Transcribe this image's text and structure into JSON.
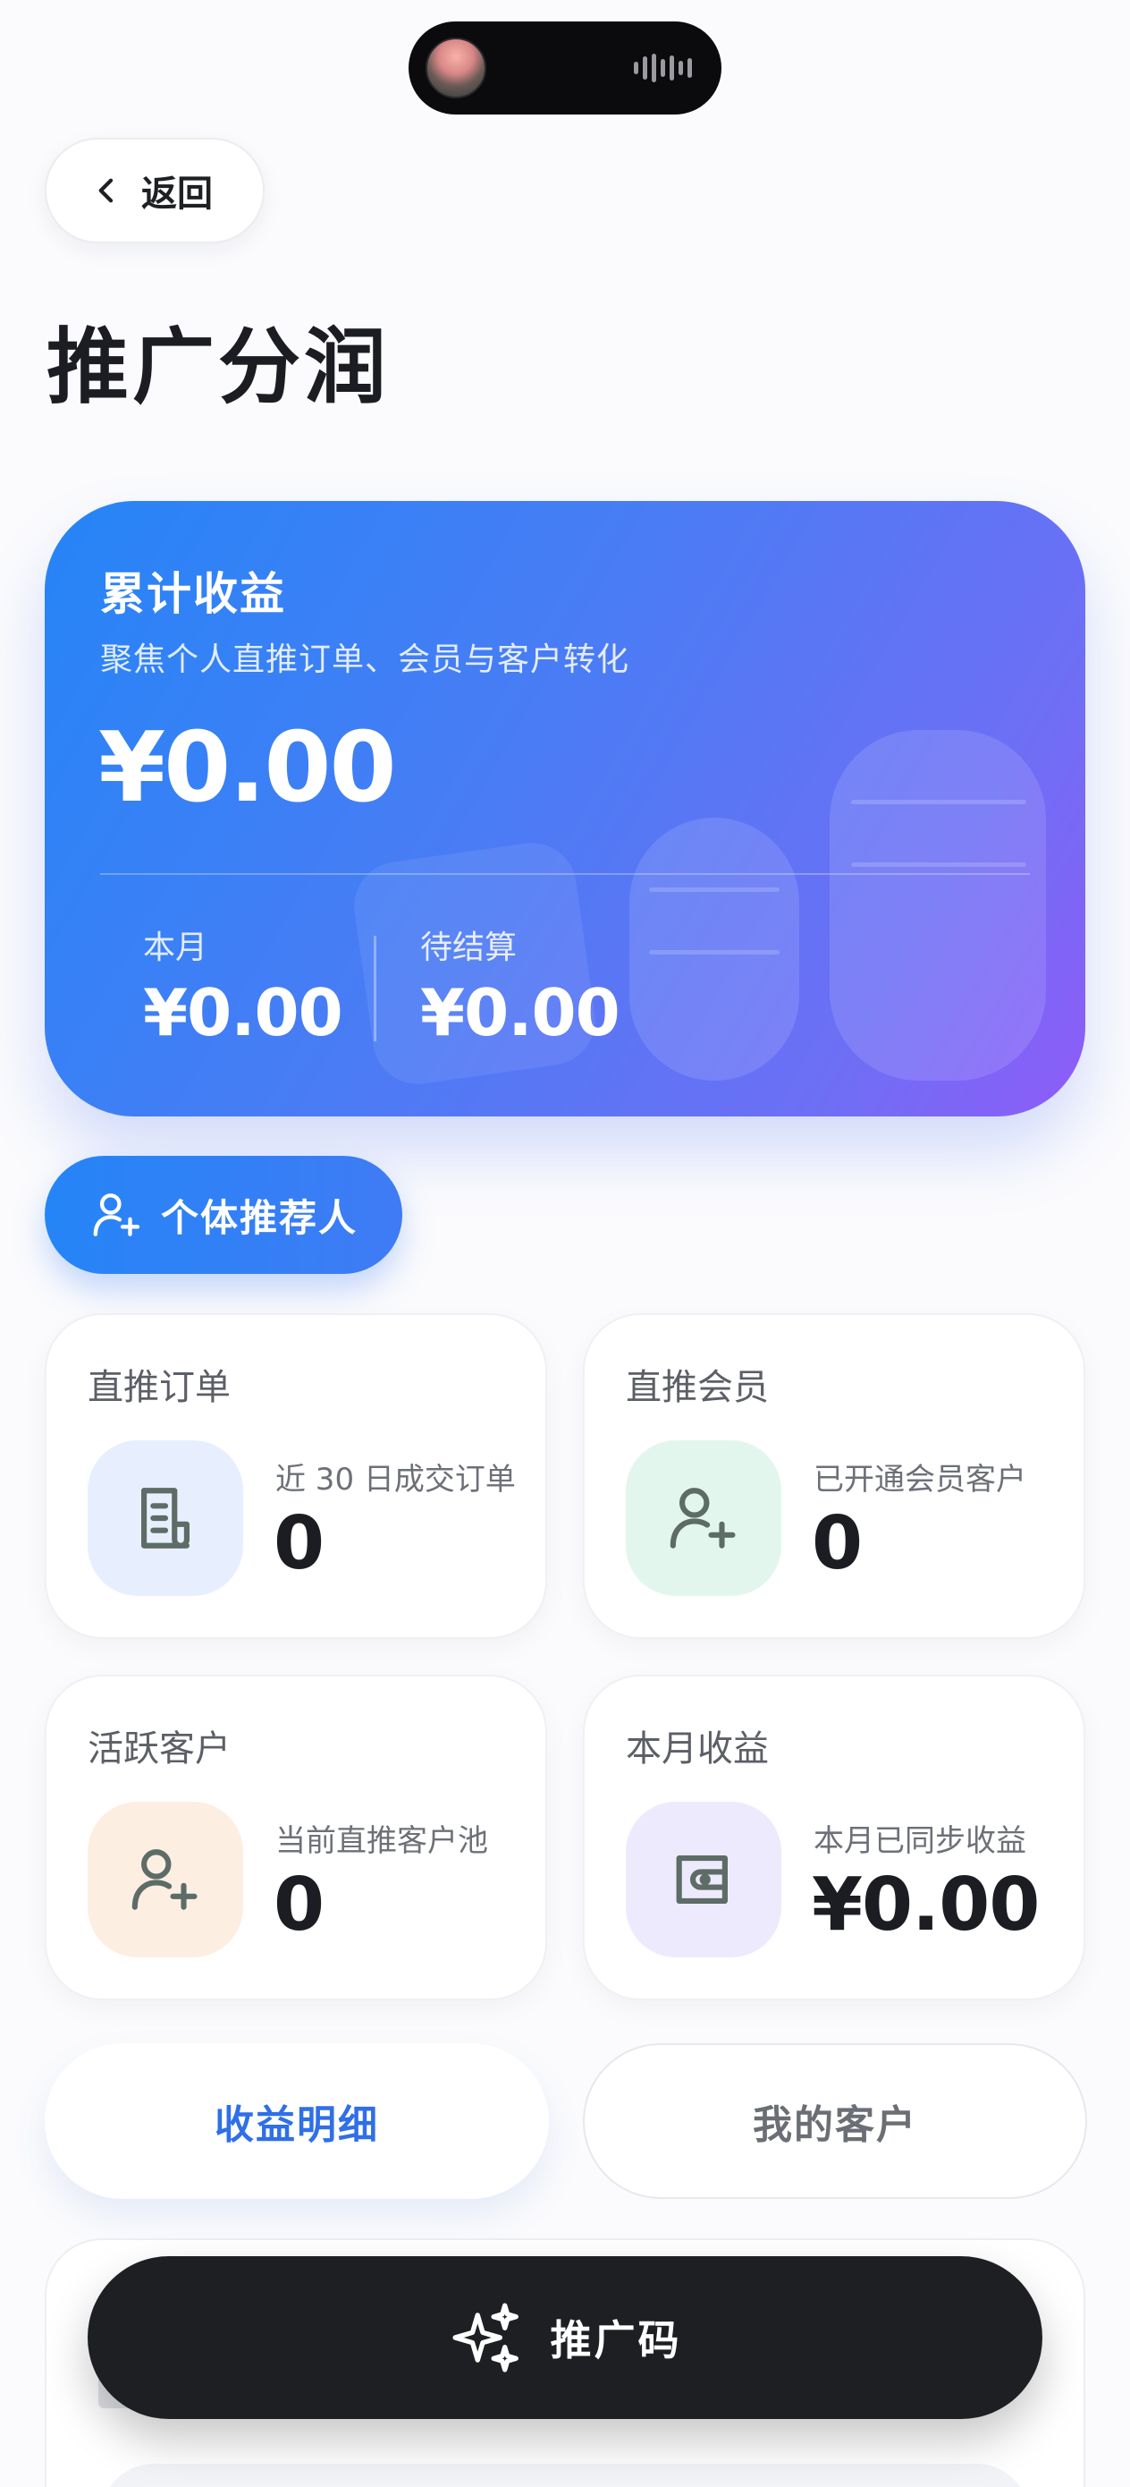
{
  "nav": {
    "back_label": "返回"
  },
  "page": {
    "title": "推广分润"
  },
  "earnings": {
    "title": "累计收益",
    "subtitle": "聚焦个人直推订单、会员与客户转化",
    "total": "¥0.00",
    "month_label": "本月",
    "month_value": "¥0.00",
    "pending_label": "待结算",
    "pending_value": "¥0.00"
  },
  "role": {
    "label": "个体推荐人",
    "icon": "user-plus-icon"
  },
  "stats": [
    {
      "title": "直推订单",
      "desc": "近 30 日成交订单",
      "value": "0",
      "icon": "receipt-icon",
      "icon_bg": "#e7efff"
    },
    {
      "title": "直推会员",
      "desc": "已开通会员客户",
      "value": "0",
      "icon": "user-plus-icon",
      "icon_bg": "#e3f6ee"
    },
    {
      "title": "活跃客户",
      "desc": "当前直推客户池",
      "value": "0",
      "icon": "user-plus-icon",
      "icon_bg": "#fdeee2"
    },
    {
      "title": "本月收益",
      "desc": "本月已同步收益",
      "value": "¥0.00",
      "icon": "wallet-icon",
      "icon_bg": "#eeeafd"
    }
  ],
  "tabs": [
    {
      "label": "收益明细",
      "active": true
    },
    {
      "label": "我的客户",
      "active": false
    }
  ],
  "promo": {
    "label": "推广码",
    "icon": "sparkles-icon"
  },
  "colors": {
    "accent": "#2f6fe8",
    "card_start": "#2585f6",
    "card_end": "#8e5cf8",
    "dark": "#1e1f23"
  }
}
